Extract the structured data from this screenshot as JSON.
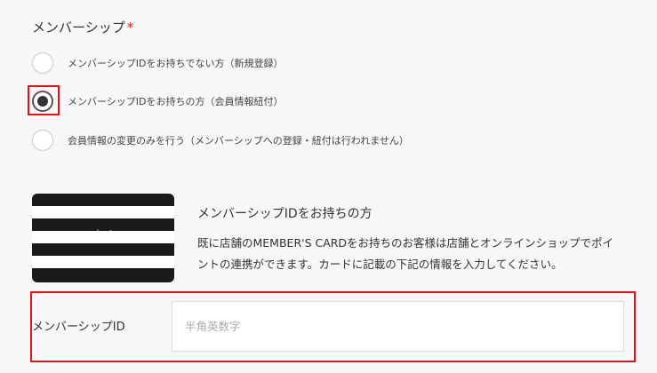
{
  "membership": {
    "title": "メンバーシップ",
    "required_mark": "*",
    "options": [
      {
        "label": "メンバーシップIDをお持ちでない方（新規登録）",
        "selected": false
      },
      {
        "label": "メンバーシップIDをお持ちの方（会員情報紐付）",
        "selected": true
      },
      {
        "label": "会員情報の変更のみを行う（メンバーシップへの登録・紐付は行われません）",
        "selected": false
      }
    ]
  },
  "card_info": {
    "logo_text": "agnès b.",
    "title": "メンバーシップIDをお持ちの方",
    "description": "既に店舗のMEMBER'S CARDをお持ちのお客様は店舗とオンラインショップでポイントの連携ができます。カードに記載の下記の情報を入力してください。"
  },
  "member_id_field": {
    "label": "メンバーシップID",
    "placeholder": "半角英数字",
    "value": ""
  },
  "colors": {
    "accent_red": "#d9141a",
    "required_red": "#e0251b",
    "background": "#f7f7f7"
  }
}
